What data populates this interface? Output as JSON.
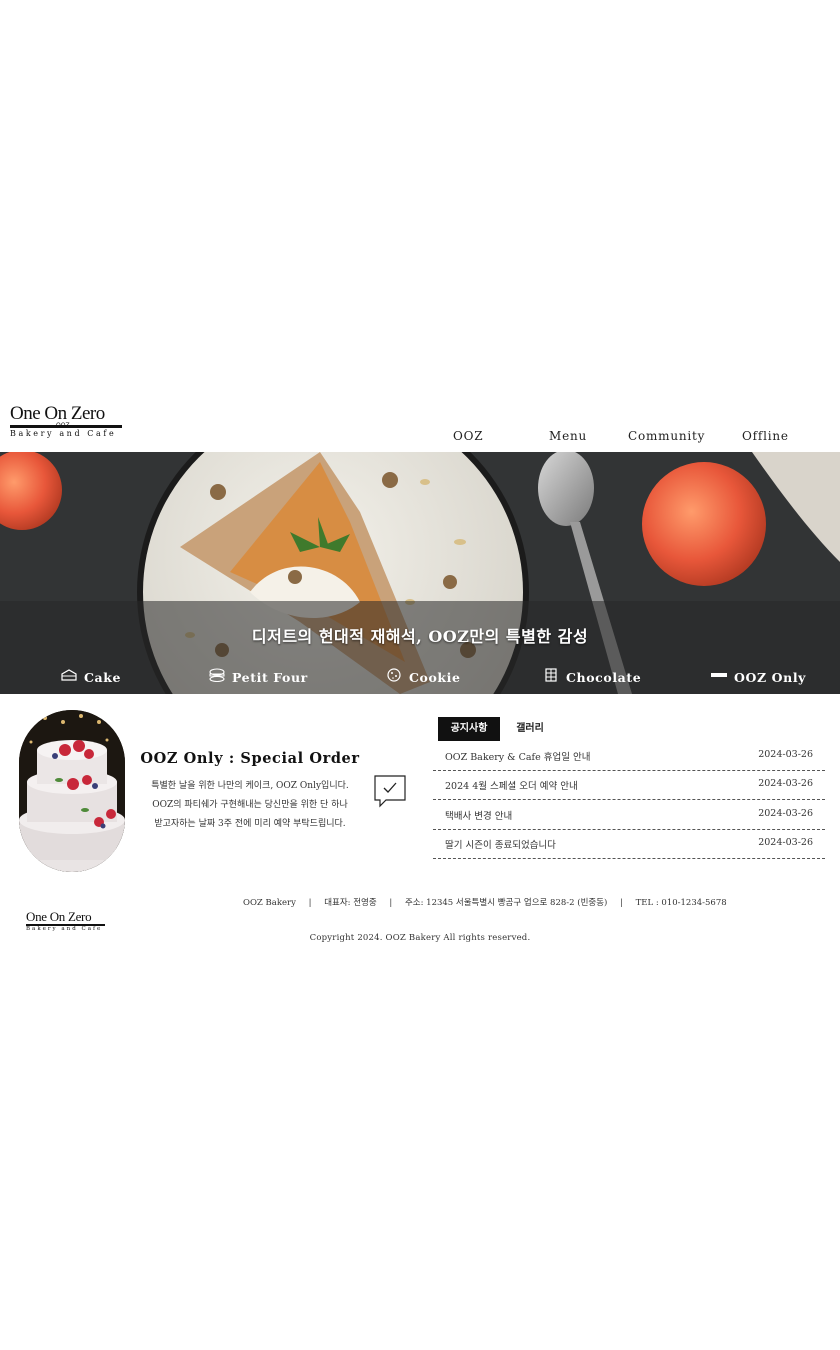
{
  "header": {
    "logo": {
      "line1": "One On Zero",
      "line0": "OOZ",
      "line2": "Bakery and Cafe"
    },
    "nav": [
      {
        "label": "OOZ"
      },
      {
        "label": "Menu"
      },
      {
        "label": "Community"
      },
      {
        "label": "Offline"
      }
    ]
  },
  "hero": {
    "tagline": "디저트의 현대적 재해석, OOZ만의 특별한 감성",
    "categories": [
      {
        "label": "Cake",
        "icon": "cake-icon"
      },
      {
        "label": "Petit Four",
        "icon": "macaron-icon"
      },
      {
        "label": "Cookie",
        "icon": "cookie-icon"
      },
      {
        "label": "Chocolate",
        "icon": "chocolate-icon"
      },
      {
        "label": "OOZ Only",
        "icon": "ooz-only-icon"
      }
    ]
  },
  "special": {
    "title": "OOZ Only : Special Order",
    "desc": [
      "특별한 날을 위한 나만의 케이크, OOZ Only입니다.",
      "OOZ의 파티쉐가 구현해내는 당신만을 위한 단 하나",
      "받고자하는 날짜 3주 전에 미리 예약 부탁드립니다."
    ]
  },
  "board": {
    "tabs": [
      {
        "label": "공지사항",
        "active": true
      },
      {
        "label": "갤러리",
        "active": false
      }
    ],
    "notices": [
      {
        "title": "OOZ Bakery & Cafe 휴업일 안내",
        "date": "2024-03-26"
      },
      {
        "title": "2024 4월 스페셜 오더 예약 안내",
        "date": "2024-03-26"
      },
      {
        "title": "택배사 변경 안내",
        "date": "2024-03-26"
      },
      {
        "title": "딸기 시즌이 종료되었습니다",
        "date": "2024-03-26"
      }
    ]
  },
  "footer": {
    "logo": {
      "line1": "One On Zero",
      "line2": "Bakery and Cafe"
    },
    "company": "OOZ Bakery",
    "ceo": "대표자: 전영중",
    "address": "주소: 12345 서울특별시 빵곰구 업으로 828-2 (빈중동)",
    "tel": "TEL : 010-1234-5678",
    "separator": "|",
    "copyright": "Copyright 2024. OOZ Bakery All rights reserved."
  },
  "colors": {
    "accent": "#111111",
    "hero_bg": "#2e2f31",
    "text": "#222222"
  }
}
